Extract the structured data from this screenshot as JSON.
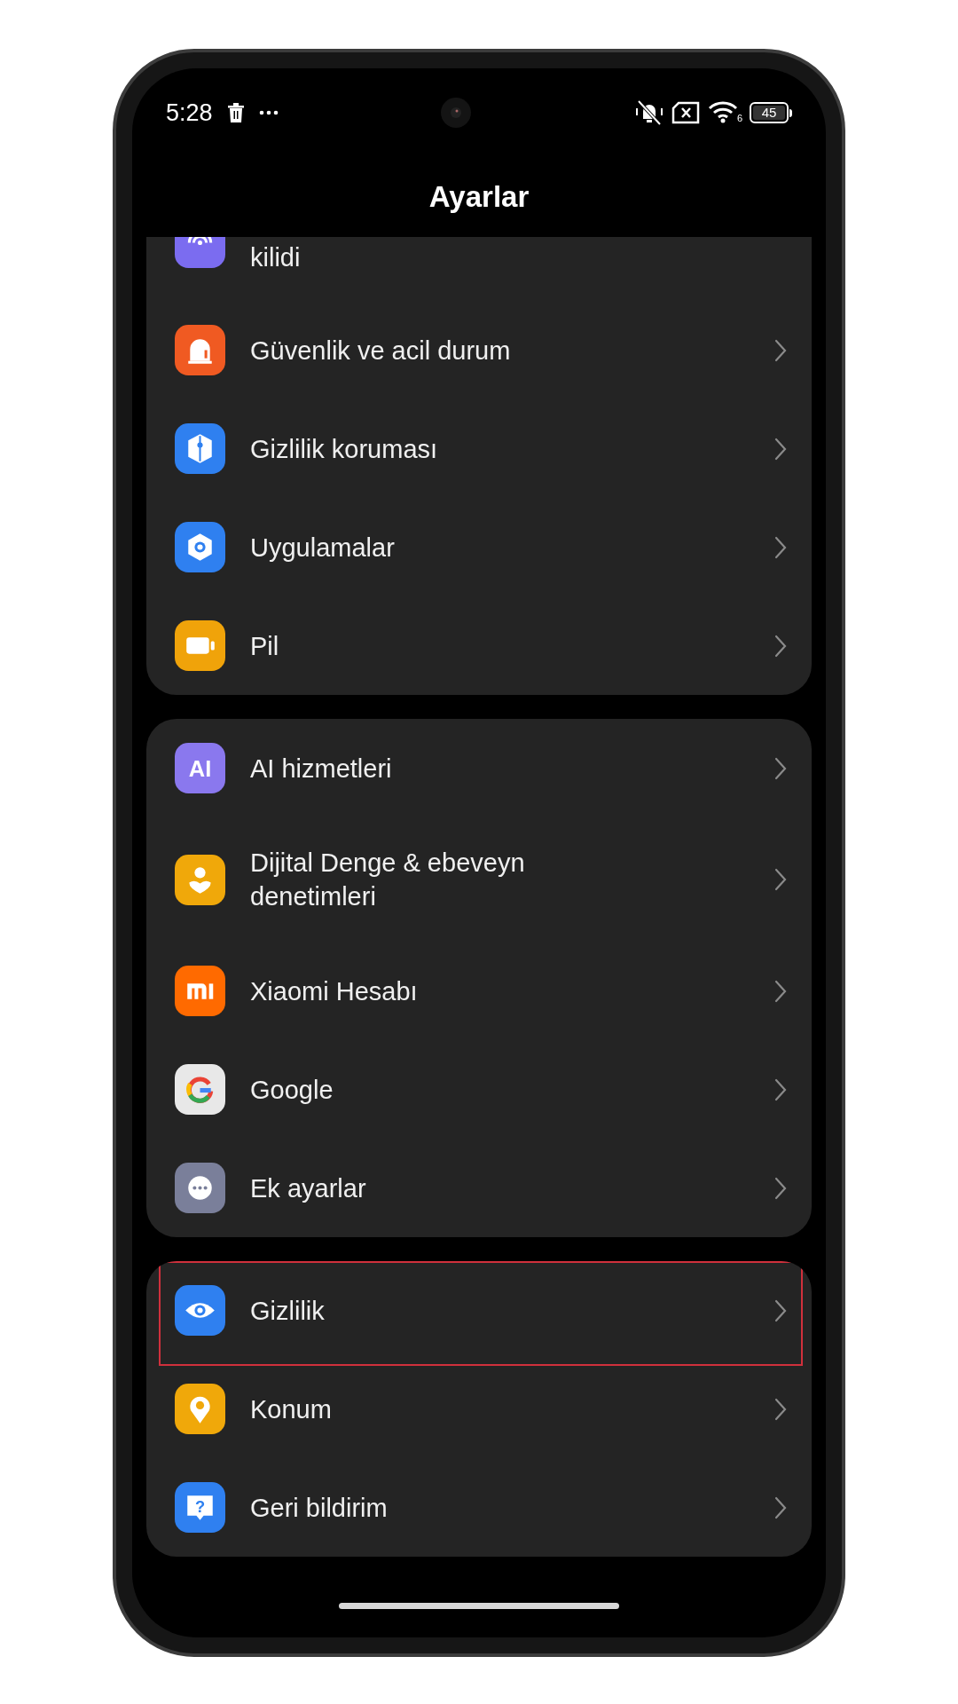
{
  "status_bar": {
    "time": "5:28",
    "wifi_badge": "6",
    "battery": "45"
  },
  "header": {
    "title": "Ayarlar"
  },
  "groups": [
    {
      "rows": [
        {
          "label": "kilidi",
          "color": "#7b6cf0",
          "highlighted": false
        },
        {
          "label": "Güvenlik ve acil durum",
          "color": "#f05a22",
          "highlighted": false
        },
        {
          "label": "Gizlilik koruması",
          "color": "#2f80f0",
          "highlighted": false
        },
        {
          "label": "Uygulamalar",
          "color": "#2f80f0",
          "highlighted": false
        },
        {
          "label": "Pil",
          "color": "#f0a30a",
          "highlighted": false
        }
      ]
    },
    {
      "rows": [
        {
          "label": "AI hizmetleri",
          "color": "#8a78ee",
          "icon_text": "AI",
          "highlighted": false
        },
        {
          "label": "Dijital Denge & ebeveyn denetimleri",
          "color": "#f0a80a",
          "highlighted": false
        },
        {
          "label": "Xiaomi Hesabı",
          "color": "#ff6a00",
          "highlighted": false
        },
        {
          "label": "Google",
          "color": "#e8e8e8",
          "highlighted": false
        },
        {
          "label": "Ek ayarlar",
          "color": "#7a7f9a",
          "highlighted": false
        }
      ]
    },
    {
      "rows": [
        {
          "label": "Gizlilik",
          "color": "#2f80f0",
          "highlighted": true
        },
        {
          "label": "Konum",
          "color": "#f0a80a",
          "highlighted": false
        },
        {
          "label": "Geri bildirim",
          "color": "#2f80f0",
          "icon_text": "?",
          "highlighted": false
        }
      ]
    }
  ]
}
